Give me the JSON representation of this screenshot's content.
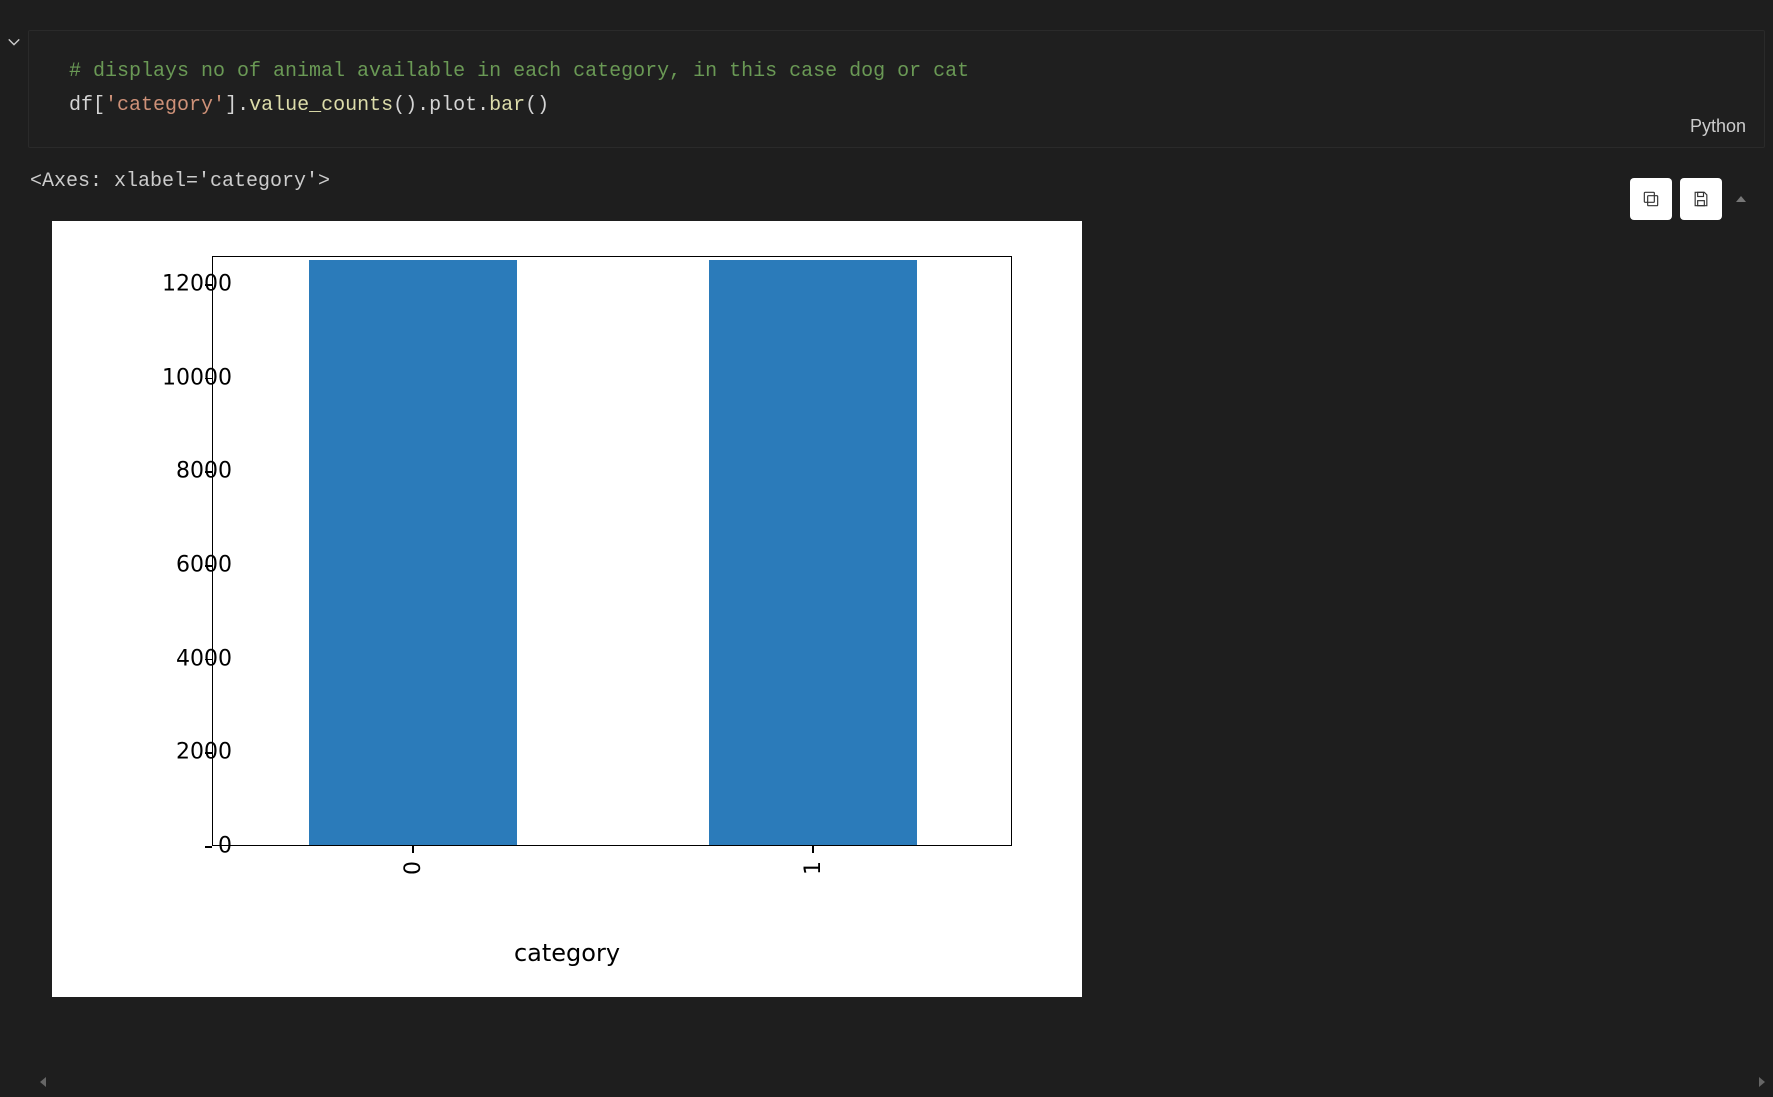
{
  "code": {
    "comment": "# displays no of animal available in each category, in this case dog or cat",
    "expr_df": "df",
    "expr_str": "'category'",
    "expr_m1": "value_counts",
    "expr_m2": "plot",
    "expr_m3": "bar"
  },
  "kernel_language": "Python",
  "output_repr": "<Axes: xlabel='category'>",
  "toolbar": {
    "copy": "copy",
    "save": "save"
  },
  "chart_data": {
    "type": "bar",
    "categories": [
      "0",
      "1"
    ],
    "values": [
      12500,
      12500
    ],
    "xlabel": "category",
    "ylabel": "",
    "ylim": [
      0,
      12600
    ],
    "yticks": [
      0,
      2000,
      4000,
      6000,
      8000,
      10000,
      12000
    ],
    "bar_color": "#2b7bba"
  }
}
